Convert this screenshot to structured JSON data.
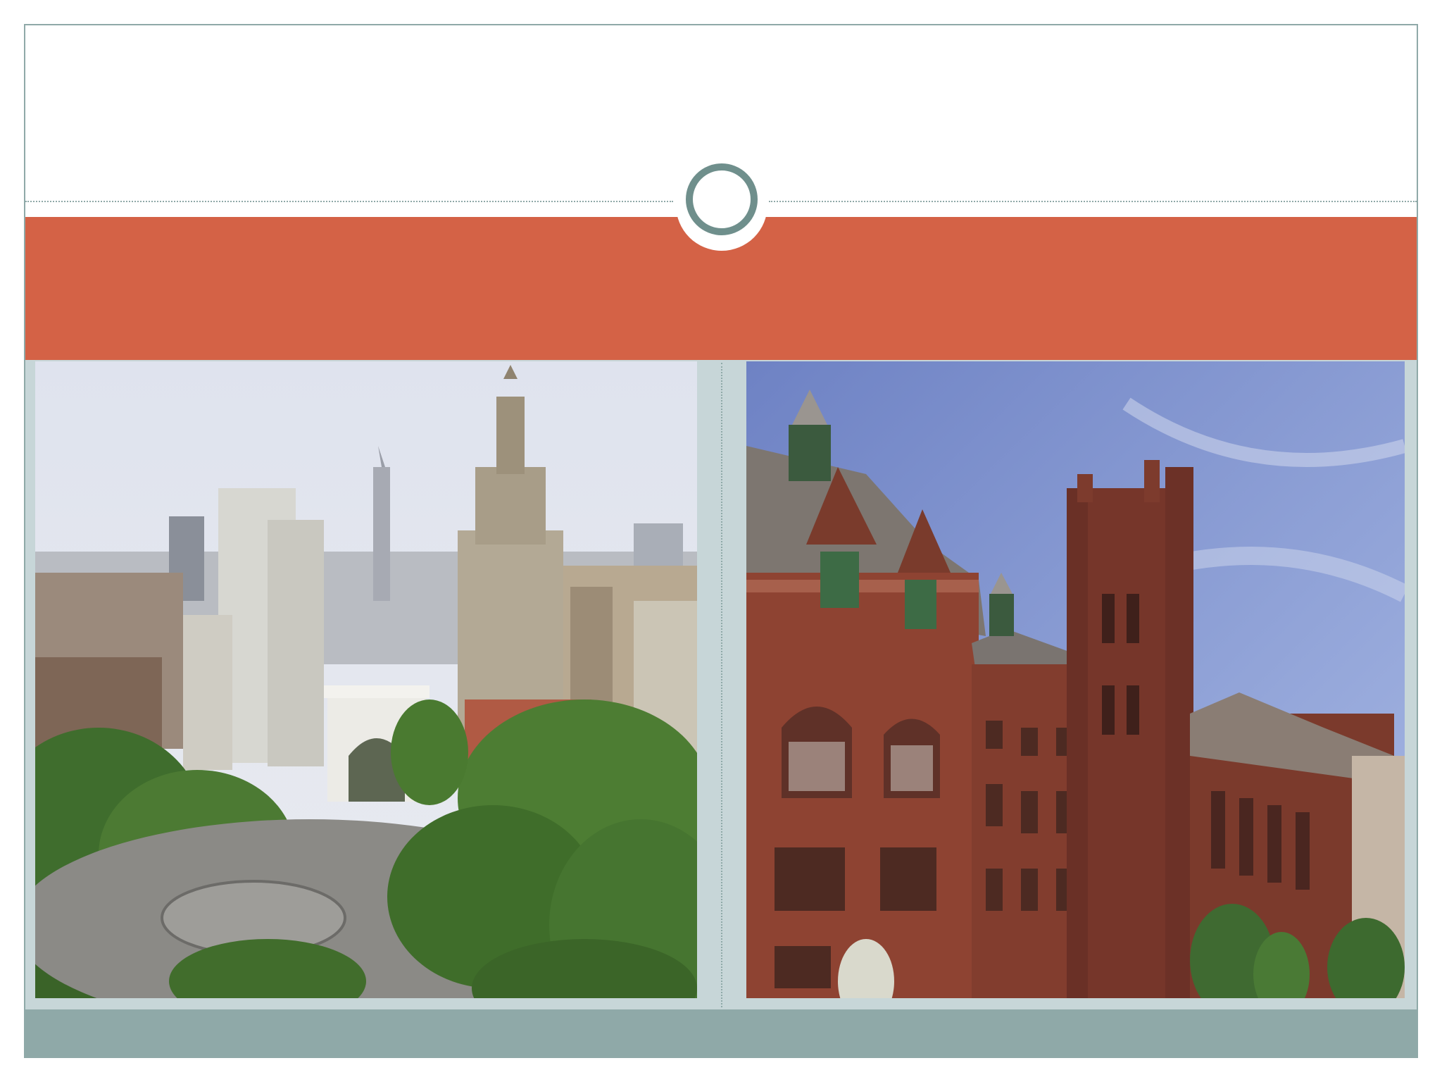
{
  "slide": {
    "title": "",
    "colors": {
      "accent_band": "#d46246",
      "frame": "#8fa9a8",
      "panel": "#c7d6d8",
      "ring": "#6f8f8c"
    }
  },
  "images": [
    {
      "name": "washington-square-park-photo"
    },
    {
      "name": "red-brick-gothic-building-photo"
    }
  ]
}
